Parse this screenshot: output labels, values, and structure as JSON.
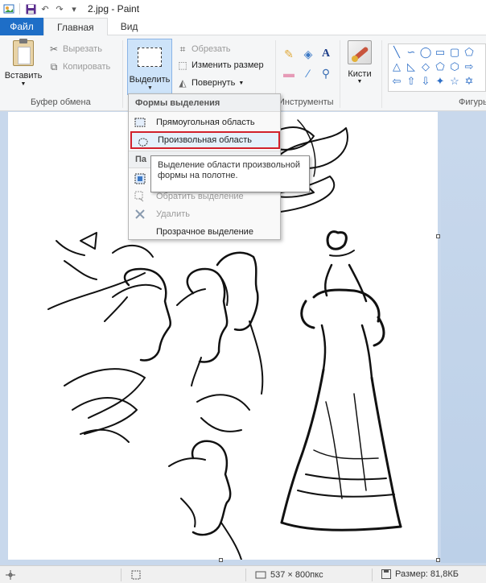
{
  "window": {
    "title": "2.jpg - Paint"
  },
  "tabs": {
    "file": "Файл",
    "home": "Главная",
    "view": "Вид"
  },
  "clipboard": {
    "paste": "Вставить",
    "cut": "Вырезать",
    "copy": "Копировать",
    "group": "Буфер обмена"
  },
  "image": {
    "select": "Выделить",
    "crop": "Обрезать",
    "resize": "Изменить размер",
    "rotate": "Повернуть"
  },
  "tools": {
    "group": "Инструменты"
  },
  "brushes": {
    "label": "Кисти"
  },
  "shapes": {
    "group": "Фигуры"
  },
  "dropdown": {
    "header": "Формы выделения",
    "rect": "Прямоугольная область",
    "freeform": "Произвольная область",
    "params_header": "Па",
    "invert": "Обратить выделение",
    "delete": "Удалить",
    "transparent": "Прозрачное выделение"
  },
  "tooltip": {
    "text": "Выделение области произвольной формы на полотне."
  },
  "status": {
    "dimensions": "537 × 800пкс",
    "size": "Размер: 81,8КБ"
  },
  "colors": {
    "accent": "#1e6ec7",
    "highlight": "#d1212b",
    "workspace": "#c8d8ec"
  }
}
